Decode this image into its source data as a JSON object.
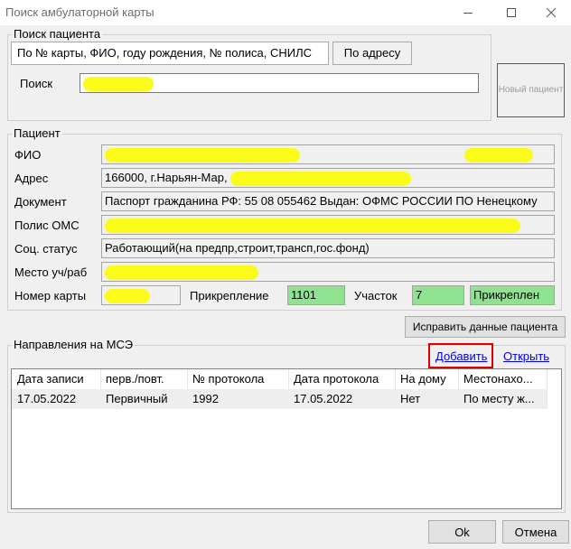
{
  "window": {
    "title": "Поиск амбулаторной карты"
  },
  "search": {
    "group_title": "Поиск пациента",
    "tabs": [
      {
        "label": "По № карты, ФИО, году рождения, № полиса, СНИЛС"
      },
      {
        "label": "По адресу"
      }
    ],
    "search_label": "Поиск",
    "search_value": "",
    "new_patient_label": "Новый пациент"
  },
  "patient": {
    "group_title": "Пациент",
    "fio_label": "ФИО",
    "address_label": "Адрес",
    "address_value": "166000, г.Нарьян-Мар,",
    "document_label": "Документ",
    "document_value": "Паспорт гражданина РФ: 55 08 055462 Выдан: ОФМС РОССИИ ПО Ненецкому",
    "policy_label": "Полис ОМС",
    "social_label": "Соц. статус",
    "social_value": "Работающий(на предпр,строит,трансп,гос.фонд)",
    "workplace_label": "Место уч/раб",
    "card_label": "Номер карты",
    "attach_label": "Прикрепление",
    "attach_value": "1101",
    "district_label": "Участок",
    "district_value": "7",
    "status_value": "Прикреплен",
    "fix_button_label": "Исправить данные пациента"
  },
  "mse": {
    "group_title": "Направления на МСЭ",
    "add_label": "Добавить",
    "open_label": "Открыть",
    "columns": [
      "Дата записи",
      "перв./повт.",
      "№ протокола",
      "Дата протокола",
      "На дому",
      "Местонахо..."
    ],
    "rows": [
      [
        "17.05.2022",
        "Первичный",
        "1992",
        "17.05.2022",
        "Нет",
        "По месту ж..."
      ]
    ]
  },
  "footer": {
    "ok_label": "Ok",
    "cancel_label": "Отмена"
  },
  "colors": {
    "highlight": "#fbfb1a",
    "green_field": "#8fe28f",
    "annotation_red": "#e00000",
    "link": "#0000ee"
  }
}
